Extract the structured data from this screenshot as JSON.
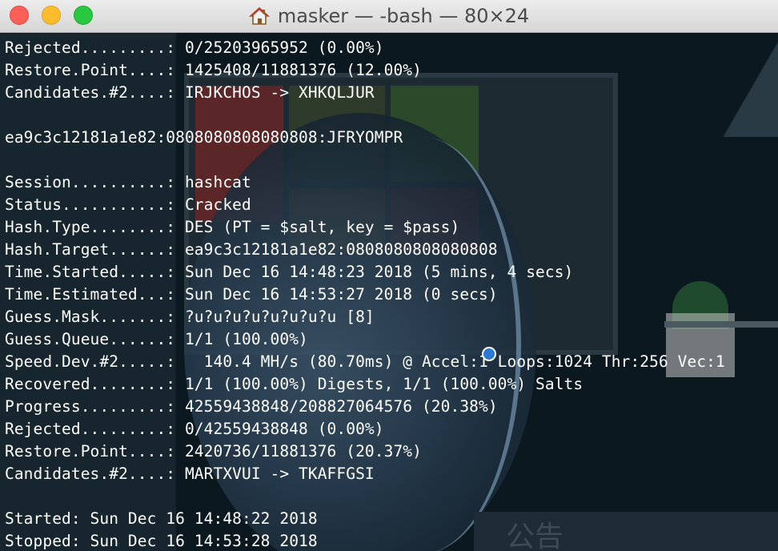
{
  "window": {
    "title": "masker — -bash — 80×24",
    "title_icon": "home-icon"
  },
  "background": {
    "bottom_text": "公告"
  },
  "terminal": {
    "lines": [
      "Rejected.........: 0/25203965952 (0.00%)",
      "Restore.Point....: 1425408/11881376 (12.00%)",
      "Candidates.#2....: IRJKCHOS -> XHKQLJUR",
      "",
      "ea9c3c12181a1e82:0808080808080808:JFRYOMPR",
      "",
      "Session..........: hashcat",
      "Status...........: Cracked",
      "Hash.Type........: DES (PT = $salt, key = $pass)",
      "Hash.Target......: ea9c3c12181a1e82:0808080808080808",
      "Time.Started.....: Sun Dec 16 14:48:23 2018 (5 mins, 4 secs)",
      "Time.Estimated...: Sun Dec 16 14:53:27 2018 (0 secs)",
      "Guess.Mask.......: ?u?u?u?u?u?u?u?u [8]",
      "Guess.Queue......: 1/1 (100.00%)",
      "Speed.Dev.#2.....:   140.4 MH/s (80.70ms) @ Accel:1 Loops:1024 Thr:256 Vec:1",
      "Recovered........: 1/1 (100.00%) Digests, 1/1 (100.00%) Salts",
      "Progress.........: 42559438848/208827064576 (20.38%)",
      "Rejected.........: 0/42559438848 (0.00%)",
      "Restore.Point....: 2420736/11881376 (20.37%)",
      "Candidates.#2....: MARTXVUI -> TKAFFGSI",
      "",
      "Started: Sun Dec 16 14:48:22 2018",
      "Stopped: Sun Dec 16 14:53:28 2018"
    ]
  },
  "colors": {
    "close": "#fc5f57",
    "minimize": "#fdbc2e",
    "maximize": "#28c840",
    "text": "#ffffff"
  }
}
